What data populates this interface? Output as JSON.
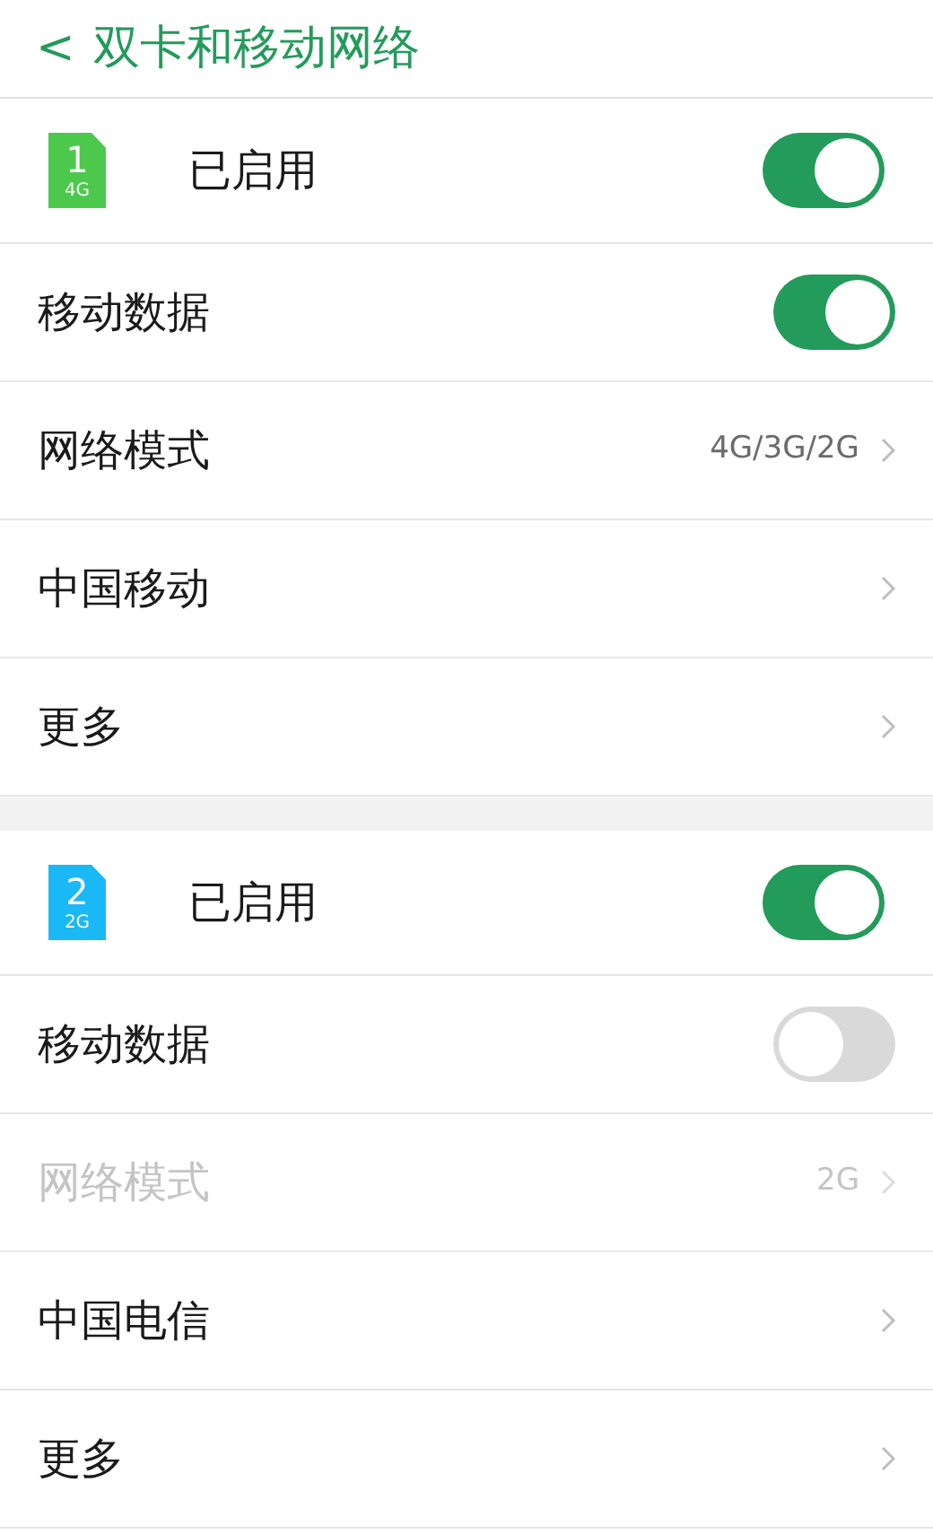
{
  "header": {
    "back": "<",
    "title": "双卡和移动网络"
  },
  "sims": [
    {
      "number": "1",
      "network": "4G",
      "color": "#4cc94c",
      "status": "已启用",
      "on": true,
      "rows": [
        {
          "kind": "toggle",
          "label": "移动数据",
          "on": true,
          "disabled": false
        },
        {
          "kind": "link",
          "label": "网络模式",
          "value": "4G/3G/2G",
          "disabled": false
        },
        {
          "kind": "link",
          "label": "中国移动",
          "disabled": false
        },
        {
          "kind": "link",
          "label": "更多",
          "disabled": false
        }
      ]
    },
    {
      "number": "2",
      "network": "2G",
      "color": "#1ab8f5",
      "status": "已启用",
      "on": true,
      "rows": [
        {
          "kind": "toggle",
          "label": "移动数据",
          "on": false,
          "disabled": false
        },
        {
          "kind": "link",
          "label": "网络模式",
          "value": "2G",
          "disabled": true
        },
        {
          "kind": "link",
          "label": "中国电信",
          "disabled": false
        },
        {
          "kind": "link",
          "label": "更多",
          "disabled": false
        }
      ]
    }
  ]
}
